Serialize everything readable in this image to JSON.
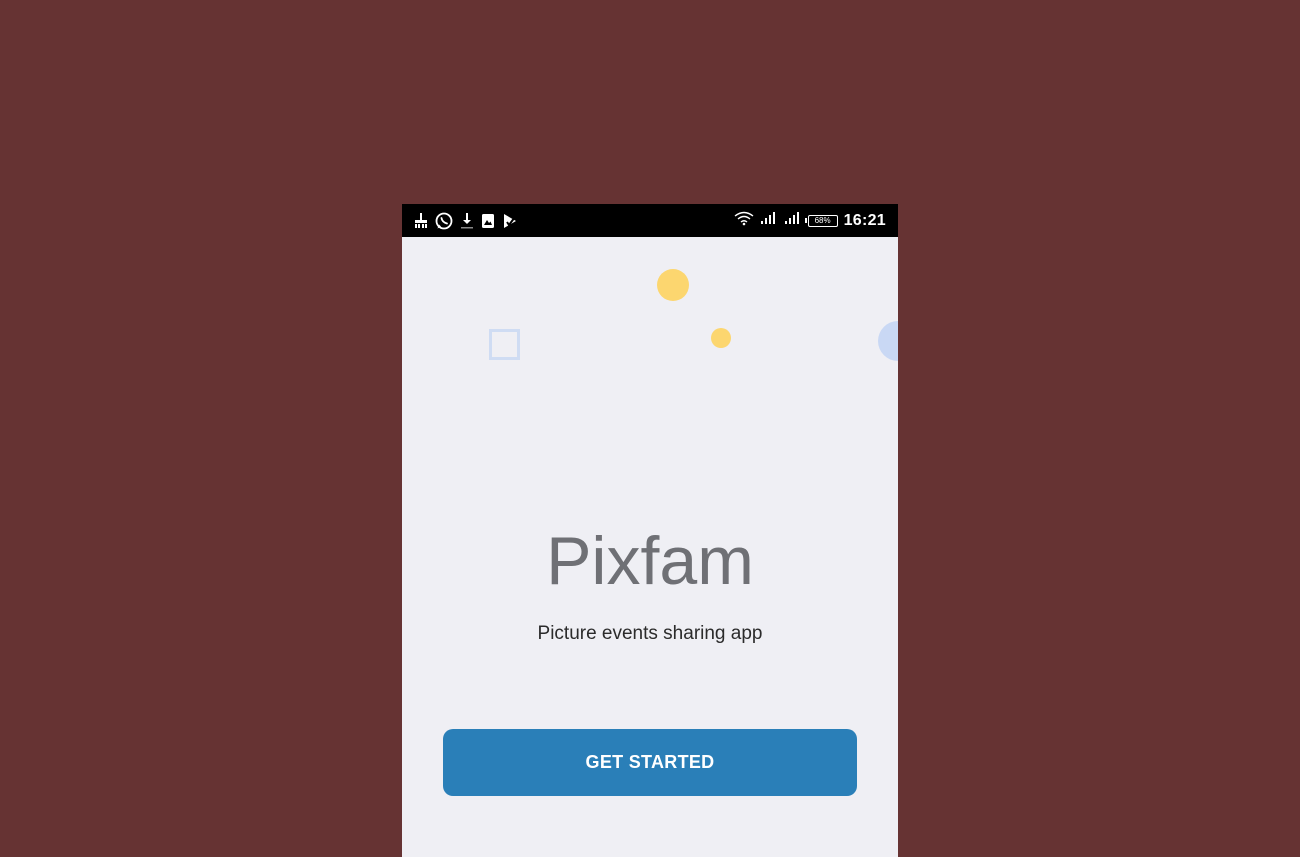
{
  "status_bar": {
    "left_icons": [
      "broom-icon",
      "whatsapp-icon",
      "download-icon",
      "gallery-icon",
      "play-store-icon"
    ],
    "right_icons": [
      "wifi-icon",
      "signal-icon",
      "signal-icon",
      "battery-icon"
    ],
    "battery_label": "68%",
    "battery_level": 0.68,
    "time": "16:21"
  },
  "onboarding": {
    "app_name": "Pixfam",
    "tagline": "Picture events sharing app",
    "cta_label": "GET STARTED"
  },
  "colors": {
    "background": "#663333",
    "screen": "#efeff4",
    "accent_yellow": "#fcd66f",
    "accent_blue_light": "#c9d8f4",
    "button": "#2a7fb8",
    "title": "#6f7075"
  }
}
